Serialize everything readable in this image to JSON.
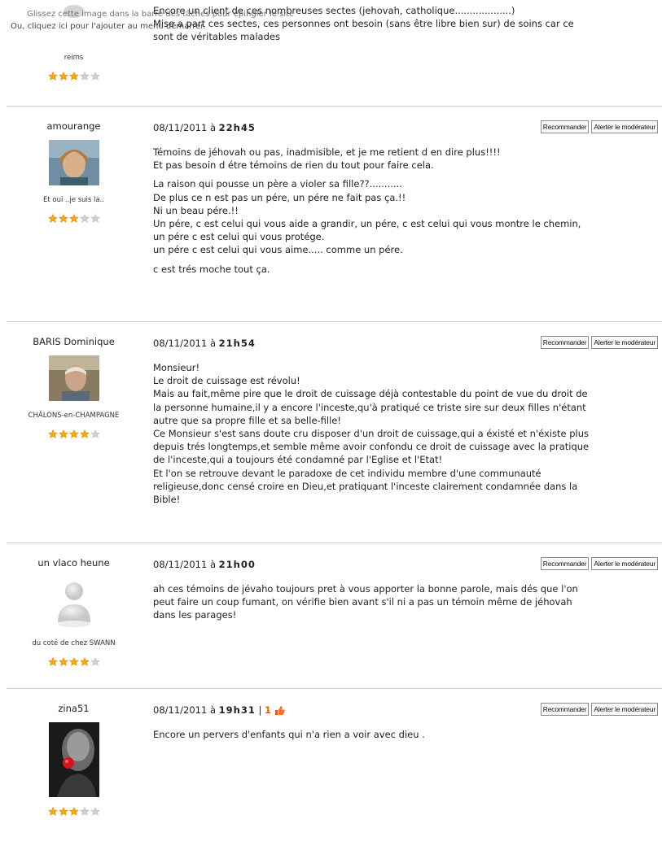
{
  "overlay": {
    "line1": "Glissez cette image dans la barre des tâches pour épingler le site",
    "line2": "Ou, cliquez ici pour l'ajouter au menu démarrer."
  },
  "buttons": {
    "recommend": "Recommander",
    "alert": "Alerter le modérateur"
  },
  "comments": [
    {
      "author": "",
      "location": "reims",
      "stars": 3,
      "lines": [
        "Encore un client de ces nombreuses sectes (jehovah, catholique...................)",
        "Mise a part ces sectes, ces personnes ont besoin (sans être libre bien sur) de soins car ce",
        "sont de véritables malades"
      ]
    },
    {
      "author": "amourange",
      "date": "08/11/2011 à",
      "time": "22h45",
      "location": "Et oui ..je suis la..",
      "stars": 3,
      "p1": [
        "Témoins de jéhovah ou pas, inadmisible, et je me retient d en dire plus!!!!",
        "Et pas besoin d étre témoins de rien du tout pour faire cela."
      ],
      "p2": [
        "La raison qui pousse un père a violer sa fille??...........",
        "De plus ce n est pas un pére, un pére ne fait pas ça.!!",
        "Ni un beau pére.!!",
        "Un pére, c est celui qui vous aide a grandir, un pére, c est celui qui vous montre le chemin,",
        "un pére c est celui qui vous protége.",
        "un pére c est celui qui vous aime..... comme un pére."
      ],
      "p3": [
        "c est trés moche tout ça."
      ]
    },
    {
      "author": "BARIS Dominique",
      "date": "08/11/2011 à",
      "time": "21h54",
      "location": "CHÂLONS-en-CHAMPAGNE",
      "stars": 4,
      "lines": [
        "Monsieur!",
        "Le droit de cuissage est révolu!",
        "Mais au fait,même pire que le droit de cuissage déjà contestable du point de vue du droit de",
        "la personne humaine,il y a encore l'inceste,qu'à pratiqué ce triste sire sur deux filles n'étant",
        "autre que sa propre fille et sa belle-fille!",
        "Ce Monsieur s'est sans doute cru disposer d'un droit de cuissage,qui a éxisté et n'éxiste plus",
        "depuis trés longtemps,et semble même avoir confondu ce droit de cuissage avec la pratique",
        "de l'inceste,qui a toujours été condamné par l'Eglise et l'Etat!",
        "Et l'on se retrouve devant le paradoxe de cet individu membre d'une communauté",
        "religieuse,donc censé croire en Dieu,et pratiquant l'inceste clairement condamnée dans la",
        "Bible!"
      ]
    },
    {
      "author": "un vlaco heune",
      "date": "08/11/2011 à",
      "time": "21h00",
      "location": "du coté de chez SWANN",
      "stars": 4,
      "lines": [
        "ah ces témoins de jévaho toujours pret à vous apporter la bonne parole, mais dés que l'on",
        "peut faire un coup fumant, on vérifie bien avant s'il ni a pas un témoin même de jéhovah",
        "dans les parages!"
      ]
    },
    {
      "author": "zina51",
      "date": "08/11/2011 à",
      "time": "19h31",
      "separator": "|",
      "likes": "1",
      "stars": 3,
      "lines": [
        "Encore un pervers d'enfants qui n'a rien a voir avec dieu ."
      ]
    }
  ]
}
